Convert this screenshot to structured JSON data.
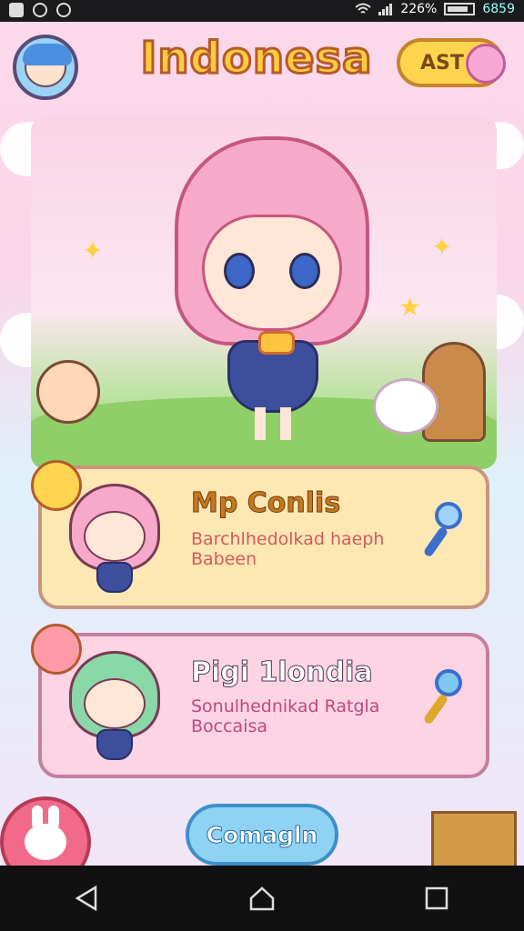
{
  "status_bar": {
    "battery_percent": "226%",
    "battery_extra": "6859"
  },
  "header": {
    "title": "Indonesa",
    "top_right_button_label": "AST"
  },
  "cards": [
    {
      "title": "Mp Conlis",
      "description_line1": "Barchlhedolkad haeph",
      "description_line2": "Babeen"
    },
    {
      "title": "Pigi 1londia",
      "description_line1": "Sonulhednikad Ratgla",
      "description_line2": "Boccaisa"
    }
  ],
  "bottom": {
    "primary_button_label": "Comagln"
  },
  "colors": {
    "title_fill": "#ffcc3f",
    "title_stroke": "#b55a2a",
    "card1_bg": "#fde8b4",
    "card2_bg": "#fcd4e4",
    "primary_button": "#8fd3f4"
  },
  "icons": [
    "wifi-icon",
    "signal-icon",
    "battery-icon",
    "key-icon",
    "map-pin-icon",
    "back-icon",
    "home-icon",
    "recents-icon",
    "bunny-icon"
  ]
}
